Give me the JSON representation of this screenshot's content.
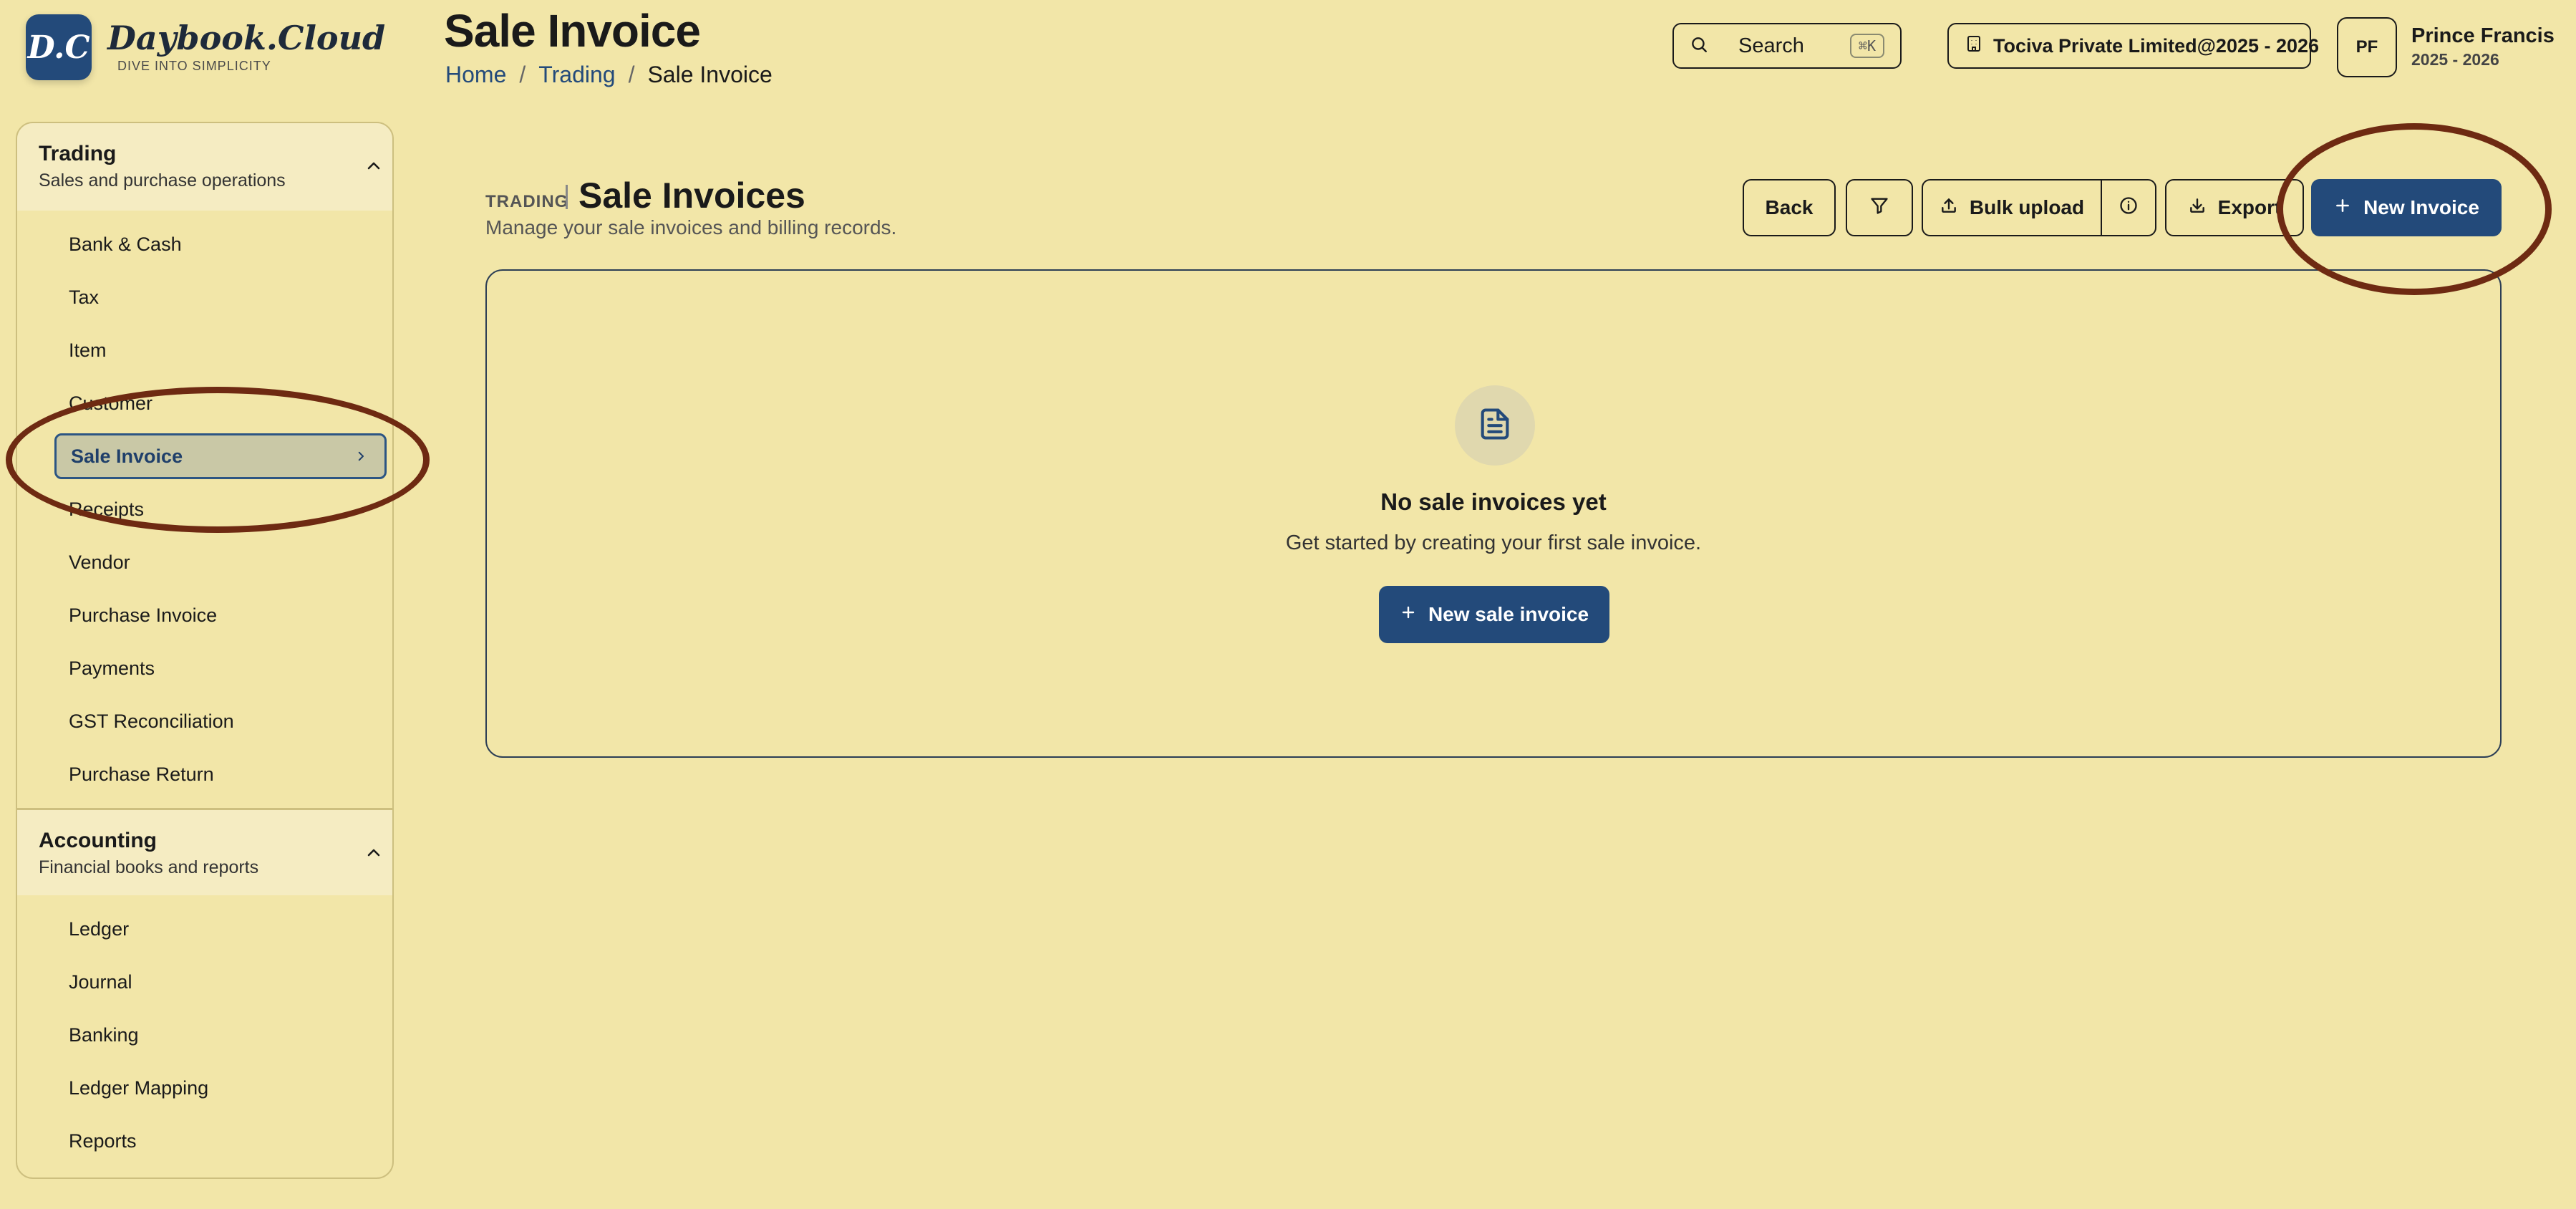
{
  "logo": {
    "badge": "D.C",
    "name": "Daybook.Cloud",
    "tagline": "DIVE INTO SIMPLICITY"
  },
  "header": {
    "page_title": "Sale Invoice",
    "breadcrumb": {
      "home": "Home",
      "sep1": "/",
      "section": "Trading",
      "sep2": "/",
      "current": "Sale Invoice"
    },
    "search": {
      "label": "Search",
      "shortcut": "⌘K"
    },
    "company": {
      "label": "Tociva Private Limited@2025 - 2026"
    },
    "user": {
      "initials": "PF",
      "name": "Prince Francis",
      "year": "2025 - 2026"
    }
  },
  "sidebar": {
    "sections": [
      {
        "title": "Trading",
        "subtitle": "Sales and purchase operations",
        "items": [
          {
            "label": "Bank & Cash"
          },
          {
            "label": "Tax"
          },
          {
            "label": "Item"
          },
          {
            "label": "Customer"
          },
          {
            "label": "Sale Invoice",
            "active": true
          },
          {
            "label": "Receipts"
          },
          {
            "label": "Vendor"
          },
          {
            "label": "Purchase Invoice"
          },
          {
            "label": "Payments"
          },
          {
            "label": "GST Reconciliation"
          },
          {
            "label": "Purchase Return"
          }
        ]
      },
      {
        "title": "Accounting",
        "subtitle": "Financial books and reports",
        "items": [
          {
            "label": "Ledger"
          },
          {
            "label": "Journal"
          },
          {
            "label": "Banking"
          },
          {
            "label": "Ledger Mapping"
          },
          {
            "label": "Reports"
          }
        ]
      }
    ]
  },
  "main": {
    "eyebrow": "TRADING",
    "title": "Sale Invoices",
    "description": "Manage your sale invoices and billing records.",
    "toolbar": {
      "back": "Back",
      "bulk_upload": "Bulk upload",
      "export": "Export",
      "new_invoice": "New Invoice"
    },
    "empty_state": {
      "title": "No sale invoices yet",
      "description": "Get started by creating your first sale invoice.",
      "button": "New sale invoice"
    }
  },
  "icons": {
    "search": "search-icon",
    "company": "building-icon",
    "chevron_up": "chevron-up-icon",
    "chevron_right": "chevron-right-icon",
    "filter": "filter-icon",
    "upload": "upload-icon",
    "info": "info-icon",
    "download": "download-icon",
    "plus": "plus-icon",
    "document": "document-icon"
  },
  "colors": {
    "background": "#f2e6a8",
    "primary": "#234a7a",
    "annotation": "#6e2a12"
  }
}
